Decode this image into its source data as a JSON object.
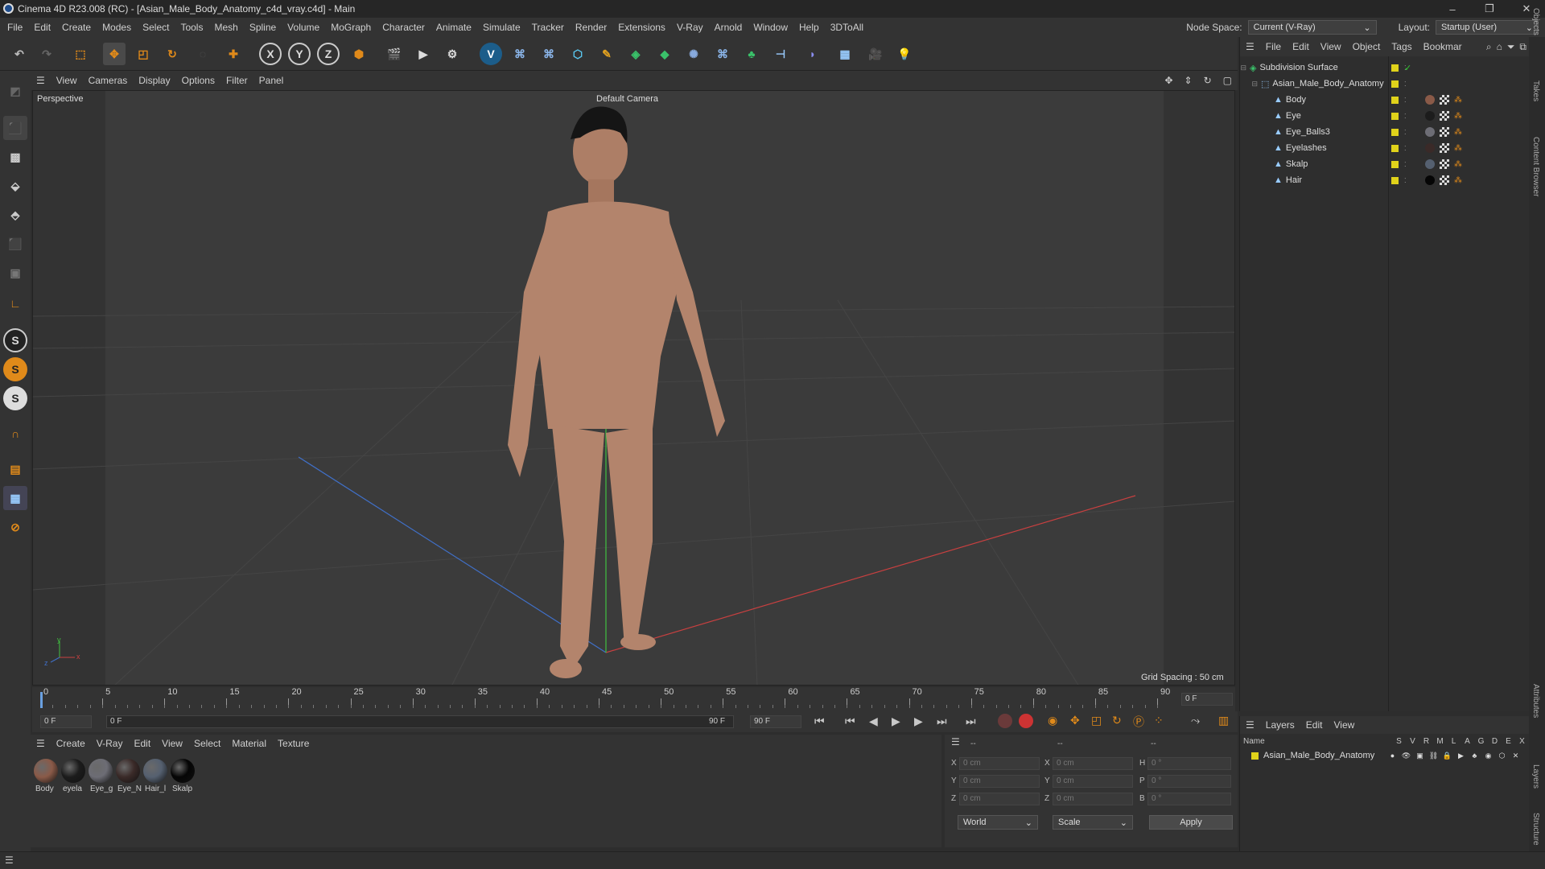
{
  "titlebar": {
    "title": "Cinema 4D R23.008 (RC) - [Asian_Male_Body_Anatomy_c4d_vray.c4d] - Main",
    "minimize": "–",
    "maximize": "❐",
    "close": "✕"
  },
  "menubar": {
    "items": [
      "File",
      "Edit",
      "Create",
      "Modes",
      "Select",
      "Tools",
      "Mesh",
      "Spline",
      "Volume",
      "MoGraph",
      "Character",
      "Animate",
      "Simulate",
      "Tracker",
      "Render",
      "Extensions",
      "V-Ray",
      "Arnold",
      "Window",
      "Help",
      "3DToAll"
    ],
    "node_space_label": "Node Space:",
    "node_space_value": "Current (V-Ray)",
    "layout_label": "Layout:",
    "layout_value": "Startup (User)"
  },
  "viewport": {
    "menu": [
      "View",
      "Cameras",
      "Display",
      "Options",
      "Filter",
      "Panel"
    ],
    "view_name": "Perspective",
    "camera": "Default Camera",
    "grid_spacing": "Grid Spacing : 50 cm",
    "axis_y": "y",
    "axis_z": "z",
    "axis_x": "x"
  },
  "timeline": {
    "ticks": [
      "0",
      "5",
      "10",
      "15",
      "20",
      "25",
      "30",
      "35",
      "40",
      "45",
      "50",
      "55",
      "60",
      "65",
      "70",
      "75",
      "80",
      "85",
      "90"
    ],
    "current_frame": "0 F",
    "start_frame": "0 F",
    "range_start": "0 F",
    "range_end": "90 F",
    "end_frame": "90 F"
  },
  "materials": {
    "menu": [
      "Create",
      "V-Ray",
      "Edit",
      "View",
      "Select",
      "Material",
      "Texture"
    ],
    "items": [
      {
        "label": "Body",
        "color": "#8a5a48"
      },
      {
        "label": "eyela",
        "color": "#1c1c1c"
      },
      {
        "label": "Eye_g",
        "color": "#6d6d75"
      },
      {
        "label": "Eye_N",
        "color": "#3a2a28"
      },
      {
        "label": "Hair_l",
        "color": "#556070"
      },
      {
        "label": "Skalp",
        "color": "#050505"
      }
    ]
  },
  "coords": {
    "header": [
      "--",
      "--",
      "--"
    ],
    "rows": [
      {
        "l1": "X",
        "v1": "0 cm",
        "l2": "X",
        "v2": "0 cm",
        "l3": "H",
        "v3": "0 °"
      },
      {
        "l1": "Y",
        "v1": "0 cm",
        "l2": "Y",
        "v2": "0 cm",
        "l3": "P",
        "v3": "0 °"
      },
      {
        "l1": "Z",
        "v1": "0 cm",
        "l2": "Z",
        "v2": "0 cm",
        "l3": "B",
        "v3": "0 °"
      }
    ],
    "world": "World",
    "scale": "Scale",
    "apply": "Apply"
  },
  "objects": {
    "menu": [
      "File",
      "Edit",
      "View",
      "Object",
      "Tags",
      "Bookmar"
    ],
    "tree": [
      {
        "label": "Subdivision Surface",
        "indent": 8
      },
      {
        "label": "Asian_Male_Body_Anatomy",
        "indent": 22
      },
      {
        "label": "Body",
        "indent": 38
      },
      {
        "label": "Eye",
        "indent": 38
      },
      {
        "label": "Eye_Balls3",
        "indent": 38
      },
      {
        "label": "Eyelashes",
        "indent": 38
      },
      {
        "label": "Skalp",
        "indent": 38
      },
      {
        "label": "Hair",
        "indent": 38
      }
    ]
  },
  "layers": {
    "menu": [
      "Layers",
      "Edit",
      "View"
    ],
    "name_header": "Name",
    "flags": [
      "S",
      "V",
      "R",
      "M",
      "L",
      "A",
      "G",
      "D",
      "E",
      "X"
    ],
    "items": [
      "Asian_Male_Body_Anatomy"
    ]
  },
  "sidetabs": [
    "Objects",
    "Takes",
    "Content Browser",
    "Attributes",
    "Layers",
    "Structure"
  ],
  "colors": {
    "accent": "#e08a1a",
    "layer": "#e0d21a",
    "axis_x": "#c84040",
    "axis_y": "#40c040",
    "axis_z": "#4070c8"
  }
}
